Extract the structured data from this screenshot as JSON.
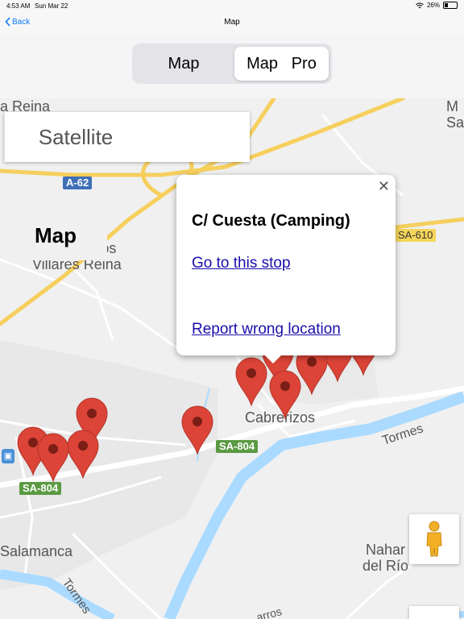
{
  "status": {
    "time": "4:53 AM",
    "date": "Sun Mar 22",
    "battery": "26%"
  },
  "nav": {
    "back_label": "Back",
    "title": "Map"
  },
  "segmented": {
    "left": "Map",
    "right": "Map   Pro",
    "selected": "right"
  },
  "map": {
    "type_buttons": {
      "map": "Map",
      "satellite": "Satellite"
    },
    "labels": {
      "la_reina": "a Reina",
      "poligono_1": "Poligono los",
      "poligono_2": "Villares Reina",
      "cabrerizos": "Cabrerizos",
      "salamanca": "Salamanca",
      "tormes_1": "Tormes",
      "tormes_2": "Tormes",
      "naharros_1": "Nahar",
      "naharros_2": "del Río",
      "corner_1": "M",
      "corner_2": "Sa",
      "bottom": "arros"
    },
    "shields": {
      "a62": "A-62",
      "sa610": "SA-610",
      "sa804_a": "SA-804",
      "sa804_b": "SA-804"
    },
    "colors": {
      "pin": "#db4437",
      "road_major": "#f6cf5d",
      "water": "#aadaff",
      "road_minor": "#ffffff"
    }
  },
  "popup": {
    "title": "C/ Cuesta (Camping)",
    "go_link": "Go to this stop",
    "report_link": "Report wrong location",
    "close": "✕"
  },
  "icons": {
    "pegman": "pegman-icon",
    "wifi": "wifi-icon",
    "battery": "battery-icon"
  }
}
